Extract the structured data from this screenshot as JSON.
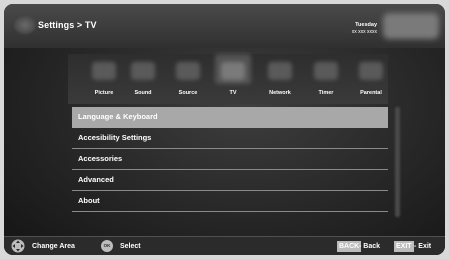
{
  "header": {
    "breadcrumb": "Settings > TV",
    "day": "Tuesday",
    "date": "xx xxx xxxx"
  },
  "tabs": [
    {
      "label": "Picture",
      "icon": "picture-icon",
      "selected": false
    },
    {
      "label": "Sound",
      "icon": "sound-icon",
      "selected": false
    },
    {
      "label": "Source",
      "icon": "source-icon",
      "selected": false
    },
    {
      "label": "TV",
      "icon": "tv-icon",
      "selected": true
    },
    {
      "label": "Network",
      "icon": "network-icon",
      "selected": false
    },
    {
      "label": "Timer",
      "icon": "timer-icon",
      "selected": false
    },
    {
      "label": "Parental",
      "icon": "parental-icon",
      "selected": false
    }
  ],
  "menu": {
    "items": [
      {
        "label": "Language & Keyboard",
        "selected": true
      },
      {
        "label": "Accesibility Settings",
        "selected": false
      },
      {
        "label": "Accessories",
        "selected": false
      },
      {
        "label": "Advanced",
        "selected": false
      },
      {
        "label": "About",
        "selected": false
      }
    ]
  },
  "footer": {
    "change_area": "Change Area",
    "ok_key": "OK",
    "select": "Select",
    "back_key": "BACK",
    "back_label": "- Back",
    "exit_key": "EXIT",
    "exit_label": "- Exit"
  },
  "colors": {
    "selected_row": "#a8a8a8",
    "key_badge": "#bcbcbc",
    "background": "#262626"
  }
}
